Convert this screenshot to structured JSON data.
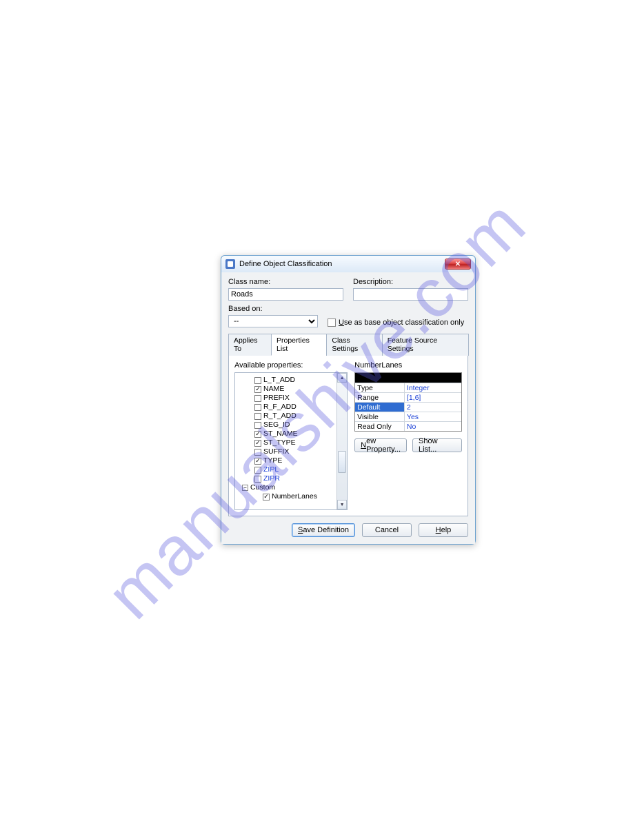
{
  "watermark": "manualshive.com",
  "dialog": {
    "title": "Define Object Classification",
    "fields": {
      "class_name_label": "Class name:",
      "class_name_value": "Roads",
      "description_label": "Description:",
      "description_value": "",
      "based_on_label": "Based on:",
      "based_on_value": "--",
      "use_as_base_label": "Use as base object classification only",
      "use_as_base_checked": false
    },
    "tabs": {
      "applies_to": "Applies To",
      "properties_list": "Properties List",
      "class_settings": "Class Settings",
      "feature_source_settings": "Feature Source Settings",
      "active": "properties_list"
    },
    "available_label": "Available properties:",
    "tree": {
      "items": [
        {
          "checked": false,
          "label": "L_T_ADD"
        },
        {
          "checked": true,
          "label": "NAME"
        },
        {
          "checked": false,
          "label": "PREFIX"
        },
        {
          "checked": false,
          "label": "R_F_ADD"
        },
        {
          "checked": false,
          "label": "R_T_ADD"
        },
        {
          "checked": false,
          "label": "SEG_ID"
        },
        {
          "checked": true,
          "label": "ST_NAME"
        },
        {
          "checked": true,
          "label": "ST_TYPE"
        },
        {
          "checked": false,
          "label": "SUFFIX"
        },
        {
          "checked": true,
          "label": "TYPE"
        },
        {
          "checked": false,
          "label": "ZIPL",
          "blue": true
        },
        {
          "checked": false,
          "label": "ZIPR",
          "blue": true
        }
      ],
      "custom": {
        "label": "Custom",
        "items": [
          {
            "checked": true,
            "label": "NumberLanes"
          }
        ]
      }
    },
    "selected_property": "NumberLanes",
    "property_details": [
      {
        "key": "Type",
        "value": "Integer",
        "selected": false
      },
      {
        "key": "Range",
        "value": "[1,6]",
        "selected": false
      },
      {
        "key": "Default",
        "value": "2",
        "selected": true
      },
      {
        "key": "Visible",
        "value": "Yes",
        "selected": false
      },
      {
        "key": "Read Only",
        "value": "No",
        "selected": false
      }
    ],
    "buttons": {
      "new_property": "New Property...",
      "show_list": "Show List...",
      "save_definition": "Save Definition",
      "cancel": "Cancel",
      "help": "Help"
    }
  }
}
